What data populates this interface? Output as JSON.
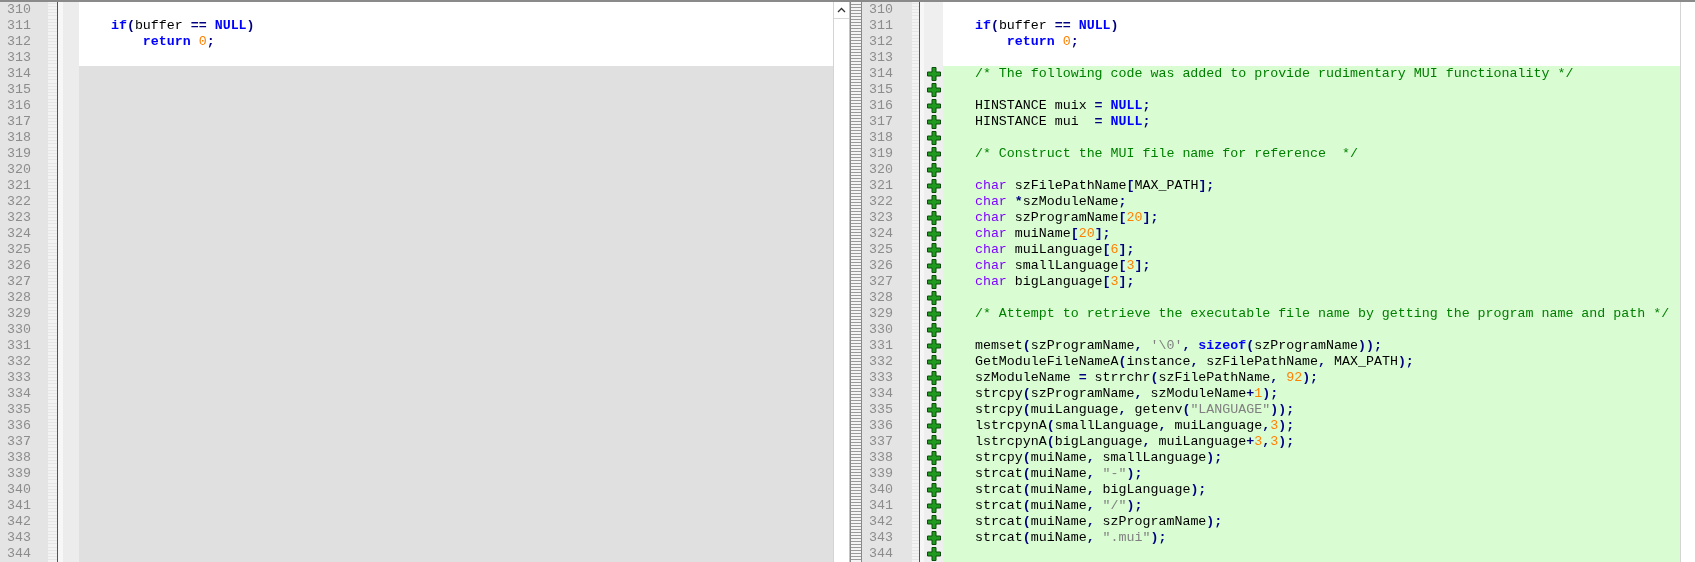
{
  "left_pane": {
    "lines": [
      {
        "number": "310",
        "kind": "context"
      },
      {
        "number": "311",
        "kind": "context",
        "tokens": [
          {
            "kind": "keyword",
            "text": "    if"
          },
          {
            "kind": "punct",
            "text": "("
          },
          {
            "kind": "plain",
            "text": "buffer "
          },
          {
            "kind": "punct",
            "text": "=="
          },
          {
            "kind": "keyword",
            "text": " NULL"
          },
          {
            "kind": "punct",
            "text": ")"
          }
        ]
      },
      {
        "number": "312",
        "kind": "context",
        "tokens": [
          {
            "kind": "keyword",
            "text": "        return"
          },
          {
            "kind": "number",
            "text": " 0"
          },
          {
            "kind": "punct",
            "text": ";"
          }
        ]
      },
      {
        "number": "313",
        "kind": "context"
      },
      {
        "number": "314",
        "kind": "missing"
      },
      {
        "number": "315",
        "kind": "missing"
      },
      {
        "number": "316",
        "kind": "missing"
      },
      {
        "number": "317",
        "kind": "missing"
      },
      {
        "number": "318",
        "kind": "missing"
      },
      {
        "number": "319",
        "kind": "missing"
      },
      {
        "number": "320",
        "kind": "missing"
      },
      {
        "number": "321",
        "kind": "missing"
      },
      {
        "number": "322",
        "kind": "missing"
      },
      {
        "number": "323",
        "kind": "missing"
      },
      {
        "number": "324",
        "kind": "missing"
      },
      {
        "number": "325",
        "kind": "missing"
      },
      {
        "number": "326",
        "kind": "missing"
      },
      {
        "number": "327",
        "kind": "missing"
      },
      {
        "number": "328",
        "kind": "missing"
      },
      {
        "number": "329",
        "kind": "missing"
      },
      {
        "number": "330",
        "kind": "missing"
      },
      {
        "number": "331",
        "kind": "missing"
      },
      {
        "number": "332",
        "kind": "missing"
      },
      {
        "number": "333",
        "kind": "missing"
      },
      {
        "number": "334",
        "kind": "missing"
      },
      {
        "number": "335",
        "kind": "missing"
      },
      {
        "number": "336",
        "kind": "missing"
      },
      {
        "number": "337",
        "kind": "missing"
      },
      {
        "number": "338",
        "kind": "missing"
      },
      {
        "number": "339",
        "kind": "missing"
      },
      {
        "number": "340",
        "kind": "missing"
      },
      {
        "number": "341",
        "kind": "missing"
      },
      {
        "number": "342",
        "kind": "missing"
      },
      {
        "number": "343",
        "kind": "missing"
      },
      {
        "number": "344",
        "kind": "missing"
      }
    ]
  },
  "right_pane": {
    "lines": [
      {
        "number": "310",
        "kind": "context"
      },
      {
        "number": "311",
        "kind": "context",
        "tokens": [
          {
            "kind": "keyword",
            "text": "    if"
          },
          {
            "kind": "punct",
            "text": "("
          },
          {
            "kind": "plain",
            "text": "buffer "
          },
          {
            "kind": "punct",
            "text": "=="
          },
          {
            "kind": "keyword",
            "text": " NULL"
          },
          {
            "kind": "punct",
            "text": ")"
          }
        ]
      },
      {
        "number": "312",
        "kind": "context",
        "tokens": [
          {
            "kind": "keyword",
            "text": "        return"
          },
          {
            "kind": "number",
            "text": " 0"
          },
          {
            "kind": "punct",
            "text": ";"
          }
        ]
      },
      {
        "number": "313",
        "kind": "context"
      },
      {
        "number": "314",
        "kind": "added",
        "tokens": [
          {
            "kind": "comment",
            "text": "    /* The following code was added to provide rudimentary MUI functionality */"
          }
        ]
      },
      {
        "number": "315",
        "kind": "added"
      },
      {
        "number": "316",
        "kind": "added",
        "tokens": [
          {
            "kind": "plain",
            "text": "    HINSTANCE muix "
          },
          {
            "kind": "punct",
            "text": "="
          },
          {
            "kind": "keyword",
            "text": " NULL"
          },
          {
            "kind": "punct",
            "text": ";"
          }
        ]
      },
      {
        "number": "317",
        "kind": "added",
        "tokens": [
          {
            "kind": "plain",
            "text": "    HINSTANCE mui  "
          },
          {
            "kind": "punct",
            "text": "="
          },
          {
            "kind": "keyword",
            "text": " NULL"
          },
          {
            "kind": "punct",
            "text": ";"
          }
        ]
      },
      {
        "number": "318",
        "kind": "added"
      },
      {
        "number": "319",
        "kind": "added",
        "tokens": [
          {
            "kind": "comment",
            "text": "    /* Construct the MUI file name for reference  */"
          }
        ]
      },
      {
        "number": "320",
        "kind": "added"
      },
      {
        "number": "321",
        "kind": "added",
        "tokens": [
          {
            "kind": "type",
            "text": "    char"
          },
          {
            "kind": "plain",
            "text": " szFilePathName"
          },
          {
            "kind": "punct",
            "text": "["
          },
          {
            "kind": "plain",
            "text": "MAX_PATH"
          },
          {
            "kind": "punct",
            "text": "];"
          }
        ]
      },
      {
        "number": "322",
        "kind": "added",
        "tokens": [
          {
            "kind": "type",
            "text": "    char"
          },
          {
            "kind": "punct",
            "text": " *"
          },
          {
            "kind": "plain",
            "text": "szModuleName"
          },
          {
            "kind": "punct",
            "text": ";"
          }
        ]
      },
      {
        "number": "323",
        "kind": "added",
        "tokens": [
          {
            "kind": "type",
            "text": "    char"
          },
          {
            "kind": "plain",
            "text": " szProgramName"
          },
          {
            "kind": "punct",
            "text": "["
          },
          {
            "kind": "number",
            "text": "20"
          },
          {
            "kind": "punct",
            "text": "];"
          }
        ]
      },
      {
        "number": "324",
        "kind": "added",
        "tokens": [
          {
            "kind": "type",
            "text": "    char"
          },
          {
            "kind": "plain",
            "text": " muiName"
          },
          {
            "kind": "punct",
            "text": "["
          },
          {
            "kind": "number",
            "text": "20"
          },
          {
            "kind": "punct",
            "text": "];"
          }
        ]
      },
      {
        "number": "325",
        "kind": "added",
        "tokens": [
          {
            "kind": "type",
            "text": "    char"
          },
          {
            "kind": "plain",
            "text": " muiLanguage"
          },
          {
            "kind": "punct",
            "text": "["
          },
          {
            "kind": "number",
            "text": "6"
          },
          {
            "kind": "punct",
            "text": "];"
          }
        ]
      },
      {
        "number": "326",
        "kind": "added",
        "tokens": [
          {
            "kind": "type",
            "text": "    char"
          },
          {
            "kind": "plain",
            "text": " smallLanguage"
          },
          {
            "kind": "punct",
            "text": "["
          },
          {
            "kind": "number",
            "text": "3"
          },
          {
            "kind": "punct",
            "text": "];"
          }
        ]
      },
      {
        "number": "327",
        "kind": "added",
        "tokens": [
          {
            "kind": "type",
            "text": "    char"
          },
          {
            "kind": "plain",
            "text": " bigLanguage"
          },
          {
            "kind": "punct",
            "text": "["
          },
          {
            "kind": "number",
            "text": "3"
          },
          {
            "kind": "punct",
            "text": "];"
          }
        ]
      },
      {
        "number": "328",
        "kind": "added"
      },
      {
        "number": "329",
        "kind": "added",
        "tokens": [
          {
            "kind": "comment",
            "text": "    /* Attempt to retrieve the executable file name by getting the program name and path */"
          }
        ]
      },
      {
        "number": "330",
        "kind": "added"
      },
      {
        "number": "331",
        "kind": "added",
        "tokens": [
          {
            "kind": "plain",
            "text": "    memset"
          },
          {
            "kind": "punct",
            "text": "("
          },
          {
            "kind": "plain",
            "text": "szProgramName"
          },
          {
            "kind": "punct",
            "text": ","
          },
          {
            "kind": "string",
            "text": " '\\0'"
          },
          {
            "kind": "punct",
            "text": ","
          },
          {
            "kind": "keyword",
            "text": " sizeof"
          },
          {
            "kind": "punct",
            "text": "("
          },
          {
            "kind": "plain",
            "text": "szProgramName"
          },
          {
            "kind": "punct",
            "text": "));"
          }
        ]
      },
      {
        "number": "332",
        "kind": "added",
        "tokens": [
          {
            "kind": "plain",
            "text": "    GetModuleFileNameA"
          },
          {
            "kind": "punct",
            "text": "("
          },
          {
            "kind": "plain",
            "text": "instance"
          },
          {
            "kind": "punct",
            "text": ","
          },
          {
            "kind": "plain",
            "text": " szFilePathName"
          },
          {
            "kind": "punct",
            "text": ","
          },
          {
            "kind": "plain",
            "text": " MAX_PATH"
          },
          {
            "kind": "punct",
            "text": ");"
          }
        ]
      },
      {
        "number": "333",
        "kind": "added",
        "tokens": [
          {
            "kind": "plain",
            "text": "    szModuleName "
          },
          {
            "kind": "punct",
            "text": "="
          },
          {
            "kind": "plain",
            "text": " strrchr"
          },
          {
            "kind": "punct",
            "text": "("
          },
          {
            "kind": "plain",
            "text": "szFilePathName"
          },
          {
            "kind": "punct",
            "text": ","
          },
          {
            "kind": "number",
            "text": " 92"
          },
          {
            "kind": "punct",
            "text": ");"
          }
        ]
      },
      {
        "number": "334",
        "kind": "added",
        "tokens": [
          {
            "kind": "plain",
            "text": "    strcpy"
          },
          {
            "kind": "punct",
            "text": "("
          },
          {
            "kind": "plain",
            "text": "szProgramName"
          },
          {
            "kind": "punct",
            "text": ","
          },
          {
            "kind": "plain",
            "text": " szModuleName"
          },
          {
            "kind": "punct",
            "text": "+"
          },
          {
            "kind": "number",
            "text": "1"
          },
          {
            "kind": "punct",
            "text": ");"
          }
        ]
      },
      {
        "number": "335",
        "kind": "added",
        "tokens": [
          {
            "kind": "plain",
            "text": "    strcpy"
          },
          {
            "kind": "punct",
            "text": "("
          },
          {
            "kind": "plain",
            "text": "muiLanguage"
          },
          {
            "kind": "punct",
            "text": ","
          },
          {
            "kind": "plain",
            "text": " getenv"
          },
          {
            "kind": "punct",
            "text": "("
          },
          {
            "kind": "string",
            "text": "\"LANGUAGE\""
          },
          {
            "kind": "punct",
            "text": "));"
          }
        ]
      },
      {
        "number": "336",
        "kind": "added",
        "tokens": [
          {
            "kind": "plain",
            "text": "    lstrcpynA"
          },
          {
            "kind": "punct",
            "text": "("
          },
          {
            "kind": "plain",
            "text": "smallLanguage"
          },
          {
            "kind": "punct",
            "text": ","
          },
          {
            "kind": "plain",
            "text": " muiLanguage"
          },
          {
            "kind": "punct",
            "text": ","
          },
          {
            "kind": "number",
            "text": "3"
          },
          {
            "kind": "punct",
            "text": ");"
          }
        ]
      },
      {
        "number": "337",
        "kind": "added",
        "tokens": [
          {
            "kind": "plain",
            "text": "    lstrcpynA"
          },
          {
            "kind": "punct",
            "text": "("
          },
          {
            "kind": "plain",
            "text": "bigLanguage"
          },
          {
            "kind": "punct",
            "text": ","
          },
          {
            "kind": "plain",
            "text": " muiLanguage"
          },
          {
            "kind": "punct",
            "text": "+"
          },
          {
            "kind": "number",
            "text": "3"
          },
          {
            "kind": "punct",
            "text": ","
          },
          {
            "kind": "number",
            "text": "3"
          },
          {
            "kind": "punct",
            "text": ");"
          }
        ]
      },
      {
        "number": "338",
        "kind": "added",
        "tokens": [
          {
            "kind": "plain",
            "text": "    strcpy"
          },
          {
            "kind": "punct",
            "text": "("
          },
          {
            "kind": "plain",
            "text": "muiName"
          },
          {
            "kind": "punct",
            "text": ","
          },
          {
            "kind": "plain",
            "text": " smallLanguage"
          },
          {
            "kind": "punct",
            "text": ");"
          }
        ]
      },
      {
        "number": "339",
        "kind": "added",
        "tokens": [
          {
            "kind": "plain",
            "text": "    strcat"
          },
          {
            "kind": "punct",
            "text": "("
          },
          {
            "kind": "plain",
            "text": "muiName"
          },
          {
            "kind": "punct",
            "text": ","
          },
          {
            "kind": "string",
            "text": " \"-\""
          },
          {
            "kind": "punct",
            "text": ");"
          }
        ]
      },
      {
        "number": "340",
        "kind": "added",
        "tokens": [
          {
            "kind": "plain",
            "text": "    strcat"
          },
          {
            "kind": "punct",
            "text": "("
          },
          {
            "kind": "plain",
            "text": "muiName"
          },
          {
            "kind": "punct",
            "text": ","
          },
          {
            "kind": "plain",
            "text": " bigLanguage"
          },
          {
            "kind": "punct",
            "text": ");"
          }
        ]
      },
      {
        "number": "341",
        "kind": "added",
        "tokens": [
          {
            "kind": "plain",
            "text": "    strcat"
          },
          {
            "kind": "punct",
            "text": "("
          },
          {
            "kind": "plain",
            "text": "muiName"
          },
          {
            "kind": "punct",
            "text": ","
          },
          {
            "kind": "string",
            "text": " \"/\""
          },
          {
            "kind": "punct",
            "text": ");"
          }
        ]
      },
      {
        "number": "342",
        "kind": "added",
        "tokens": [
          {
            "kind": "plain",
            "text": "    strcat"
          },
          {
            "kind": "punct",
            "text": "("
          },
          {
            "kind": "plain",
            "text": "muiName"
          },
          {
            "kind": "punct",
            "text": ","
          },
          {
            "kind": "plain",
            "text": " szProgramName"
          },
          {
            "kind": "punct",
            "text": ");"
          }
        ]
      },
      {
        "number": "343",
        "kind": "added",
        "tokens": [
          {
            "kind": "plain",
            "text": "    strcat"
          },
          {
            "kind": "punct",
            "text": "("
          },
          {
            "kind": "plain",
            "text": "muiName"
          },
          {
            "kind": "punct",
            "text": ","
          },
          {
            "kind": "string",
            "text": " \".mui\""
          },
          {
            "kind": "punct",
            "text": ");"
          }
        ]
      },
      {
        "number": "344",
        "kind": "added"
      }
    ]
  }
}
